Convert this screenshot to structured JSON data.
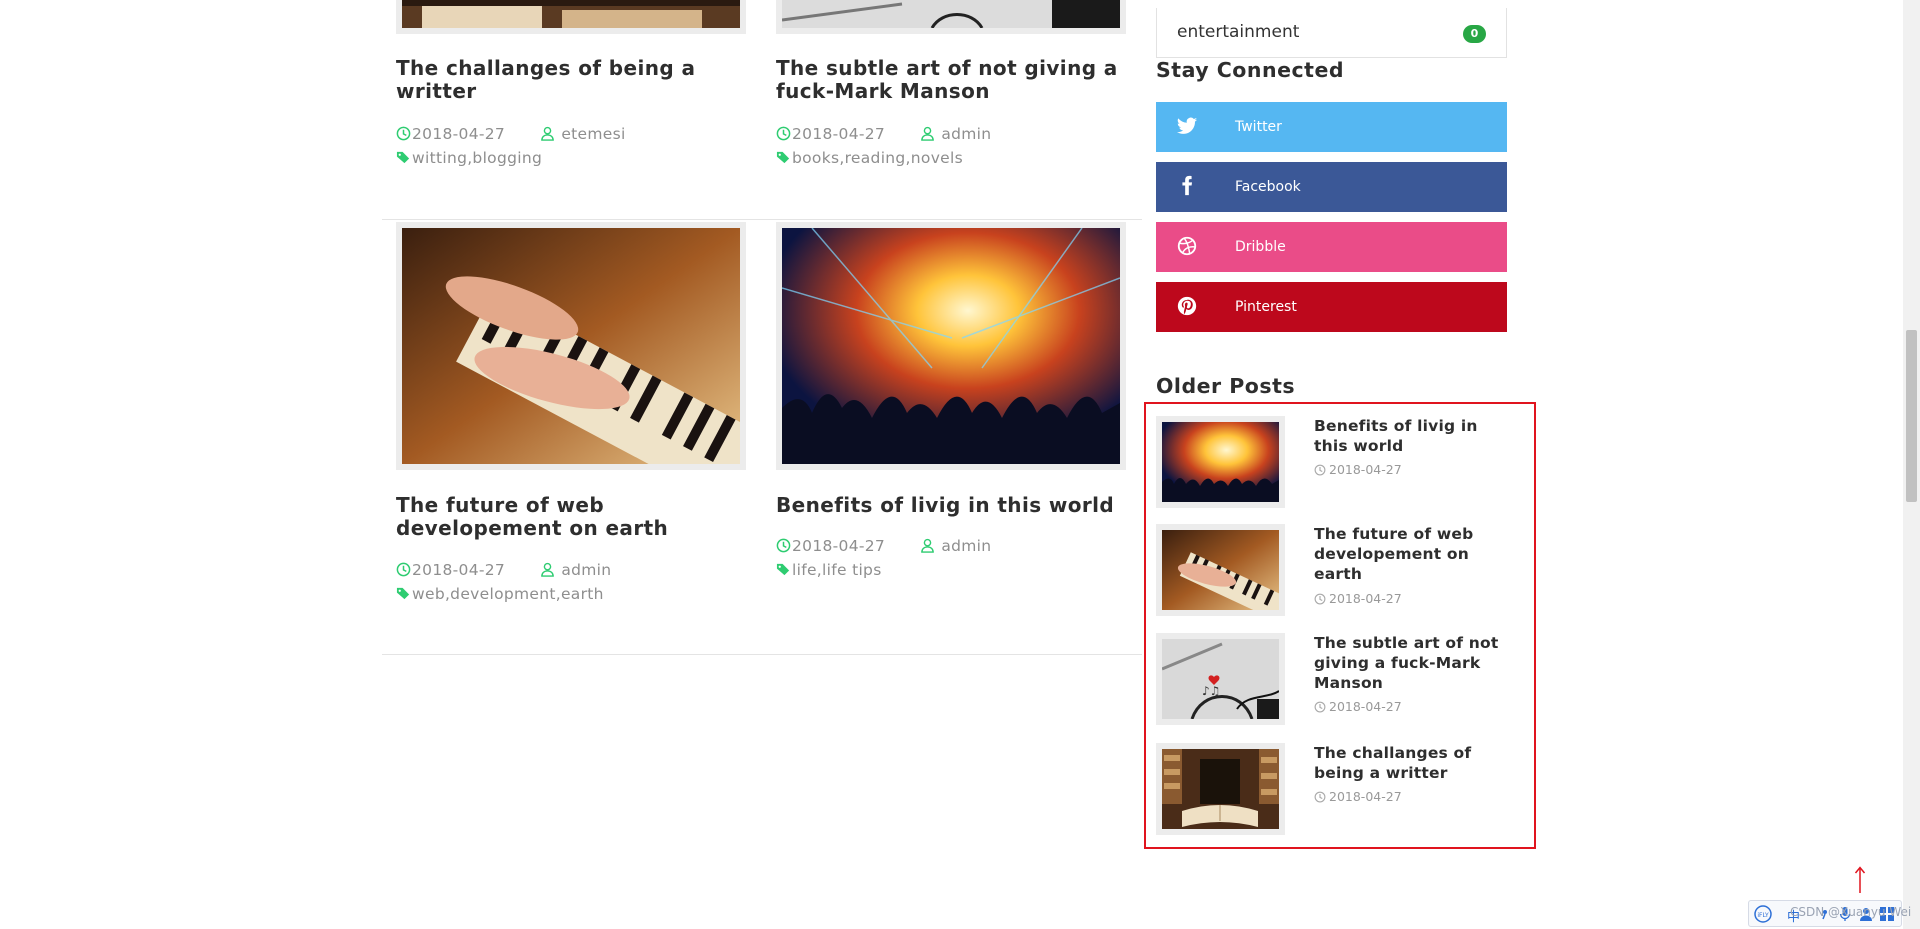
{
  "posts": [
    {
      "title": "The challanges of being a writter",
      "date": "2018-04-27",
      "author": "etemesi",
      "tags": "witting,blogging"
    },
    {
      "title": "The subtle art of not giving a fuck-Mark Manson",
      "date": "2018-04-27",
      "author": "admin",
      "tags": "books,reading,novels"
    },
    {
      "title": "The future of web developement on earth",
      "date": "2018-04-27",
      "author": "admin",
      "tags": "web,development,earth"
    },
    {
      "title": "Benefits of livig in this world",
      "date": "2018-04-27",
      "author": "admin",
      "tags": "life,life tips"
    }
  ],
  "sidebar": {
    "category": {
      "name": "entertainment",
      "count": "0"
    },
    "stay_connected_heading": "Stay Connected",
    "social": [
      {
        "label": "Twitter",
        "icon": "twitter-icon",
        "color": "#55b7f2"
      },
      {
        "label": "Facebook",
        "icon": "facebook-icon",
        "color": "#3b5897"
      },
      {
        "label": "Dribble",
        "icon": "dribbble-icon",
        "color": "#ea4c88"
      },
      {
        "label": "Pinterest",
        "icon": "pinterest-icon",
        "color": "#bd081c"
      }
    ],
    "older_posts_heading": "Older Posts",
    "older_posts": [
      {
        "title": "Benefits of livig in this world",
        "date": "2018-04-27"
      },
      {
        "title": "The future of web developement on earth",
        "date": "2018-04-27"
      },
      {
        "title": "The subtle art of not giving a fuck-Mark Manson",
        "date": "2018-04-27"
      },
      {
        "title": "The challanges of being a writter",
        "date": "2018-04-27"
      }
    ]
  },
  "toolbar": {
    "ime_label": "中",
    "watermark": "CSDN @Xuanyu Wei"
  },
  "colors": {
    "accent_green": "#2ecc71",
    "highlight_red": "#e0141e"
  }
}
